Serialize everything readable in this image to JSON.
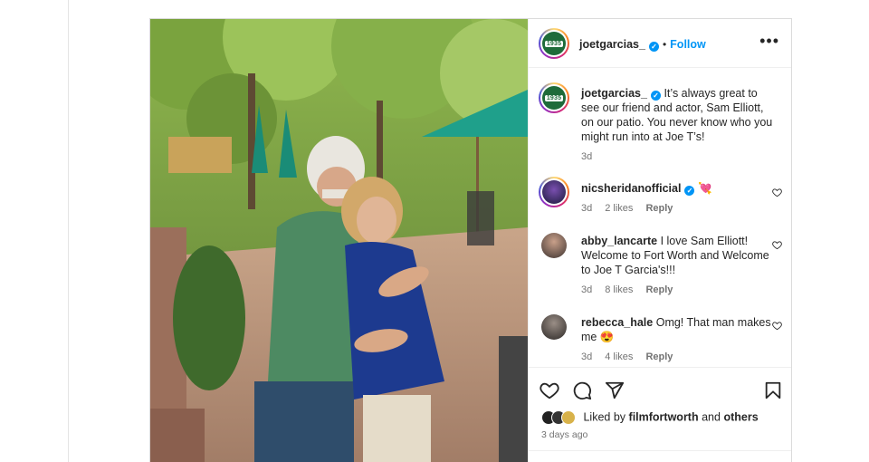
{
  "post": {
    "author": {
      "username": "joetgarcias_",
      "verified": true,
      "follow_label": "Follow",
      "separator": "•",
      "avatar_text": "1935"
    },
    "more_label": "•••",
    "caption": {
      "username": "joetgarcias_",
      "text": "It’s always great to see our friend and actor, Sam Elliott, on our patio. You never know who you might run into at Joe T’s!",
      "time": "3d"
    },
    "comments": [
      {
        "username": "nicsheridanofficial",
        "verified": true,
        "text": "",
        "emoji": "💘",
        "time": "3d",
        "likes": "2 likes",
        "reply_label": "Reply"
      },
      {
        "username": "abby_lancarte",
        "verified": false,
        "text": "I love Sam Elliott! Welcome to Fort Worth and Welcome to Joe T Garcia's!!!",
        "emoji": "",
        "time": "3d",
        "likes": "8 likes",
        "reply_label": "Reply"
      },
      {
        "username": "rebecca_hale",
        "verified": false,
        "text": "Omg! That man makes me",
        "emoji": "😍",
        "time": "3d",
        "likes": "4 likes",
        "reply_label": "Reply"
      }
    ],
    "liked_by": {
      "prefix": "Liked by",
      "user": "filmfortworth",
      "conjunction": "and",
      "others": "others"
    },
    "posted_ago": "3 days ago",
    "icons": [
      "heart-icon",
      "comment-icon",
      "share-icon",
      "bookmark-icon"
    ],
    "colors": {
      "accent": "#0095f6",
      "text": "#262626",
      "muted": "#737373"
    }
  }
}
